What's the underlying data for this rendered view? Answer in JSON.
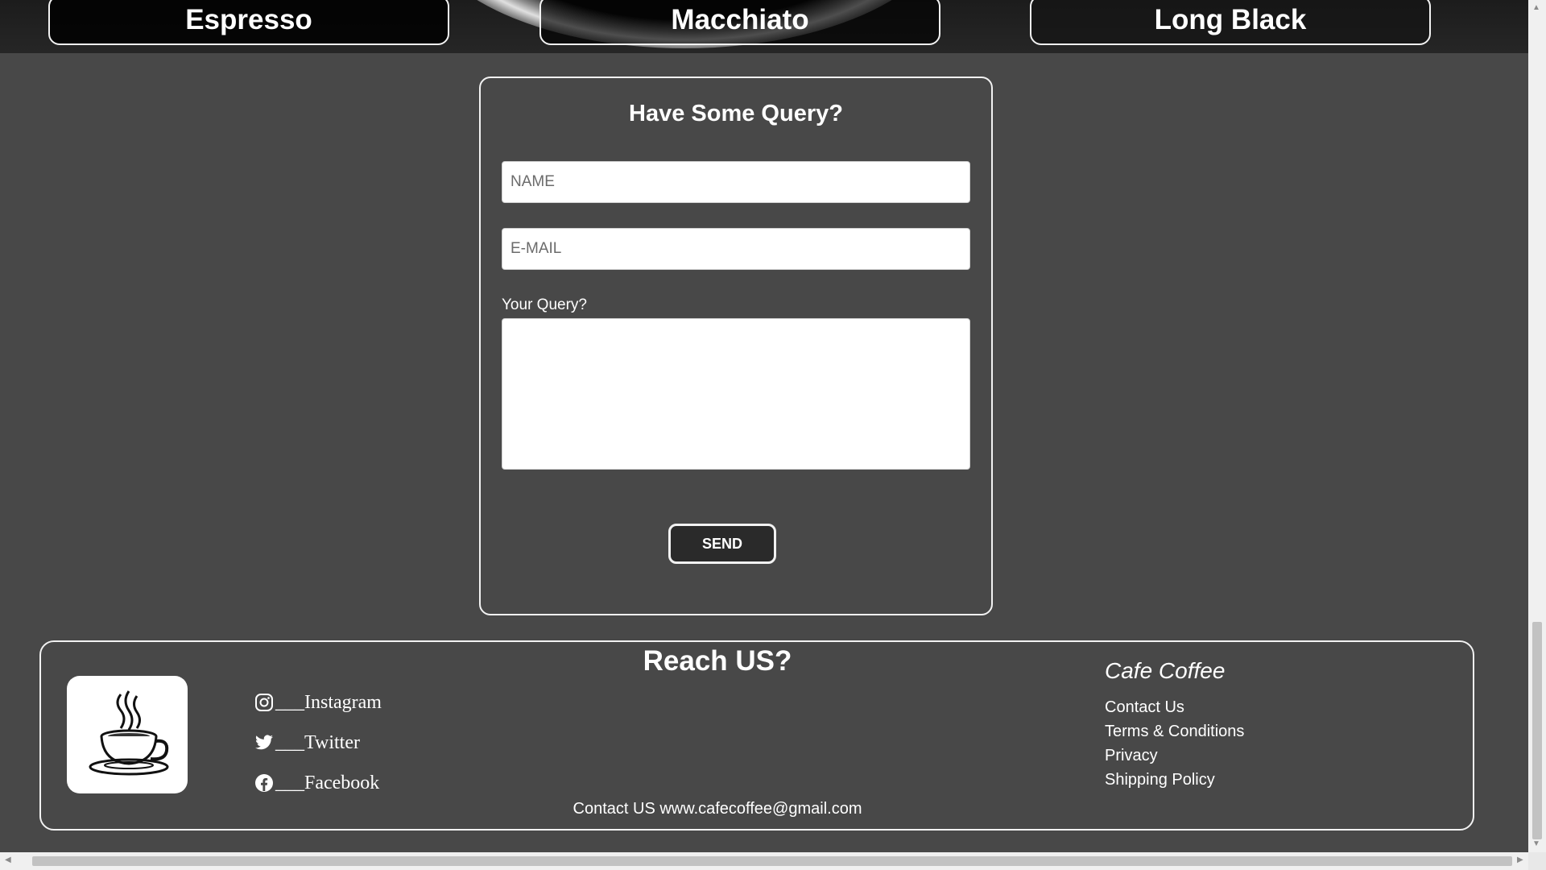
{
  "coffee_cards": [
    {
      "label": "Espresso"
    },
    {
      "label": "Macchiato"
    },
    {
      "label": "Long Black"
    }
  ],
  "query_form": {
    "title": "Have Some Query?",
    "name_placeholder": "NAME",
    "email_placeholder": "E-MAIL",
    "query_label": "Your Query?",
    "send_label": "SEND"
  },
  "footer": {
    "title": "Reach US?",
    "logo_icon": "coffee-cup-icon",
    "socials": [
      {
        "label": "___Instagram",
        "icon": "instagram-icon"
      },
      {
        "label": "___Twitter",
        "icon": "twitter-icon"
      },
      {
        "label": "___Facebook",
        "icon": "facebook-icon"
      }
    ],
    "brand": "Cafe Coffee",
    "links": [
      "Contact Us",
      "Terms & Conditions",
      "Privacy",
      "Shipping Policy"
    ],
    "contact_line": "Contact US www.cafecoffee@gmail.com"
  },
  "colors": {
    "page_background": "#484848",
    "border": "#f2f2f2",
    "button_background": "#2a2a2a"
  }
}
